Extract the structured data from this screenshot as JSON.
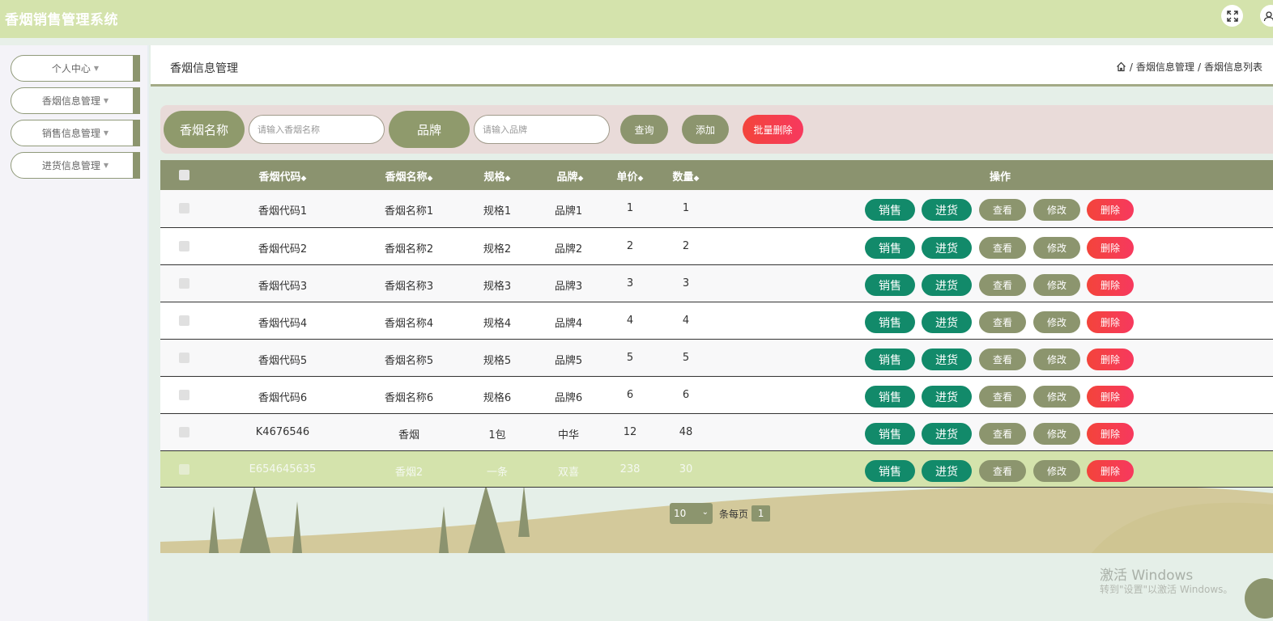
{
  "app": {
    "title": "香烟销售管理系统"
  },
  "sidebar": {
    "items": [
      {
        "label": "个人中心"
      },
      {
        "label": "香烟信息管理"
      },
      {
        "label": "销售信息管理"
      },
      {
        "label": "进货信息管理"
      }
    ]
  },
  "header": {
    "page_title": "香烟信息管理",
    "breadcrumb": [
      "香烟信息管理",
      "香烟信息列表"
    ]
  },
  "search": {
    "name_label": "香烟名称",
    "name_placeholder": "请输入香烟名称",
    "brand_label": "品牌",
    "brand_placeholder": "请输入品牌",
    "query_btn": "查询",
    "add_btn": "添加",
    "batch_delete_btn": "批量删除"
  },
  "table": {
    "columns": [
      "香烟代码",
      "香烟名称",
      "规格",
      "品牌",
      "单价",
      "数量",
      "操作"
    ],
    "rows": [
      {
        "code": "香烟代码1",
        "name": "香烟名称1",
        "spec": "规格1",
        "brand": "品牌1",
        "price": "1",
        "qty": "1"
      },
      {
        "code": "香烟代码2",
        "name": "香烟名称2",
        "spec": "规格2",
        "brand": "品牌2",
        "price": "2",
        "qty": "2"
      },
      {
        "code": "香烟代码3",
        "name": "香烟名称3",
        "spec": "规格3",
        "brand": "品牌3",
        "price": "3",
        "qty": "3"
      },
      {
        "code": "香烟代码4",
        "name": "香烟名称4",
        "spec": "规格4",
        "brand": "品牌4",
        "price": "4",
        "qty": "4"
      },
      {
        "code": "香烟代码5",
        "name": "香烟名称5",
        "spec": "规格5",
        "brand": "品牌5",
        "price": "5",
        "qty": "5"
      },
      {
        "code": "香烟代码6",
        "name": "香烟名称6",
        "spec": "规格6",
        "brand": "品牌6",
        "price": "6",
        "qty": "6"
      },
      {
        "code": "K4676546",
        "name": "香烟",
        "spec": "1包",
        "brand": "中华",
        "price": "12",
        "qty": "48"
      },
      {
        "code": "E654645635",
        "name": "香烟2",
        "spec": "一条",
        "brand": "双喜",
        "price": "238",
        "qty": "30"
      }
    ],
    "actions": {
      "sell": "销售",
      "stock": "进货",
      "view": "查看",
      "edit": "修改",
      "delete": "删除"
    }
  },
  "pager": {
    "page_size": "10",
    "per_page_label": "条每页",
    "current_page": "1"
  },
  "watermark": {
    "line1": "激活 Windows",
    "line2": "转到\"设置\"以激活 Windows。"
  },
  "colors": {
    "topbar": "#d4e3ac",
    "olive": "#8c956e",
    "green_btn": "#128a6a",
    "red_btn": "#f3443b",
    "highlight_row": "#d4e3ac"
  },
  "icons": {
    "fullscreen": "fullscreen-icon",
    "user": "user-icon",
    "home": "home-icon"
  }
}
